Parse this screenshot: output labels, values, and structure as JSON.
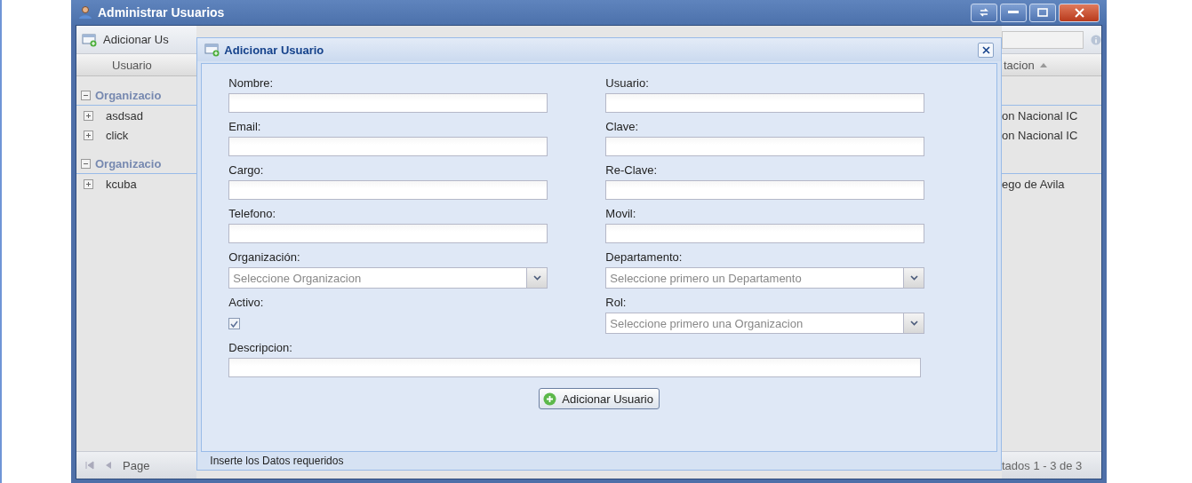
{
  "window": {
    "title": "Administrar Usuarios"
  },
  "toolbar": {
    "add_button": "Adicionar Us"
  },
  "grid": {
    "column_1": "Usuario",
    "column_2": "tacion",
    "groups": [
      {
        "label": "Organizacio",
        "expanded": true,
        "rows": [
          {
            "user": "asdsad",
            "location": "on Nacional IC",
            "expanded": false
          },
          {
            "user": "click",
            "location": "on Nacional IC",
            "expanded": false
          }
        ]
      },
      {
        "label": "Organizacio",
        "expanded": true,
        "rows": [
          {
            "user": "kcuba",
            "location": "ego de Avila",
            "expanded": false
          }
        ]
      }
    ]
  },
  "paging": {
    "page_label": "Page",
    "summary": "tados 1 - 3 de 3"
  },
  "dialog": {
    "title": "Adicionar Usuario",
    "fields": [
      {
        "label": "Nombre:",
        "kind": "text"
      },
      {
        "label": "Usuario:",
        "kind": "text"
      },
      {
        "label": "Email:",
        "kind": "text"
      },
      {
        "label": "Clave:",
        "kind": "text"
      },
      {
        "label": "Cargo:",
        "kind": "text"
      },
      {
        "label": "Re-Clave:",
        "kind": "text"
      },
      {
        "label": "Telefono:",
        "kind": "text"
      },
      {
        "label": "Movil:",
        "kind": "text"
      },
      {
        "label": "Organización:",
        "kind": "select",
        "placeholder": "Seleccione Organizacion"
      },
      {
        "label": "Departamento:",
        "kind": "select",
        "placeholder": "Seleccione primero un Departamento"
      },
      {
        "label": "Activo:",
        "kind": "checkbox",
        "checked": true
      },
      {
        "label": "Rol:",
        "kind": "select",
        "placeholder": "Seleccione primero una Organizacion"
      },
      {
        "label": "Descripcion:",
        "kind": "wide"
      }
    ],
    "submit": "Adicionar Usuario",
    "status": "Inserte los Datos requeridos"
  }
}
